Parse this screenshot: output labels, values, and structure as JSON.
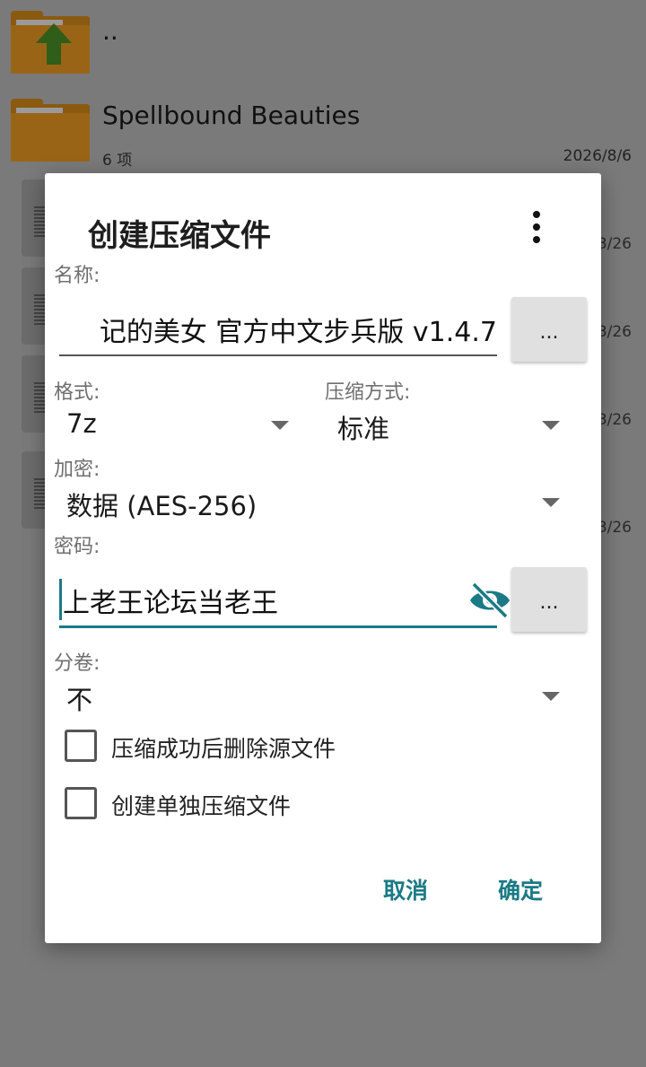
{
  "background": {
    "parent_label": "..",
    "folder_name": "Spellbound Beauties",
    "folder_count": "6 项",
    "folder_date": "2026/8/6",
    "side_dates": [
      "3/26",
      "3/26",
      "3/26",
      "3/26"
    ]
  },
  "dialog": {
    "title": "创建压缩文件",
    "name_label": "名称:",
    "name_value": "记的美女 官方中文步兵版 v1.4.7",
    "browse_label": "...",
    "format_label": "格式:",
    "format_value": "7z",
    "method_label": "压缩方式:",
    "method_value": "标准",
    "encryption_label": "加密:",
    "encryption_value": "数据 (AES-256)",
    "password_label": "密码:",
    "password_value": "上老王论坛当老王",
    "password_browse_label": "...",
    "split_label": "分卷:",
    "split_value": "不",
    "checkbox_delete": "压缩成功后删除源文件",
    "checkbox_separate": "创建单独压缩文件",
    "cancel_label": "取消",
    "ok_label": "确定"
  },
  "colors": {
    "accent": "#1b7a85",
    "folder": "#9a6416",
    "scrim": "#7a7a7a"
  }
}
